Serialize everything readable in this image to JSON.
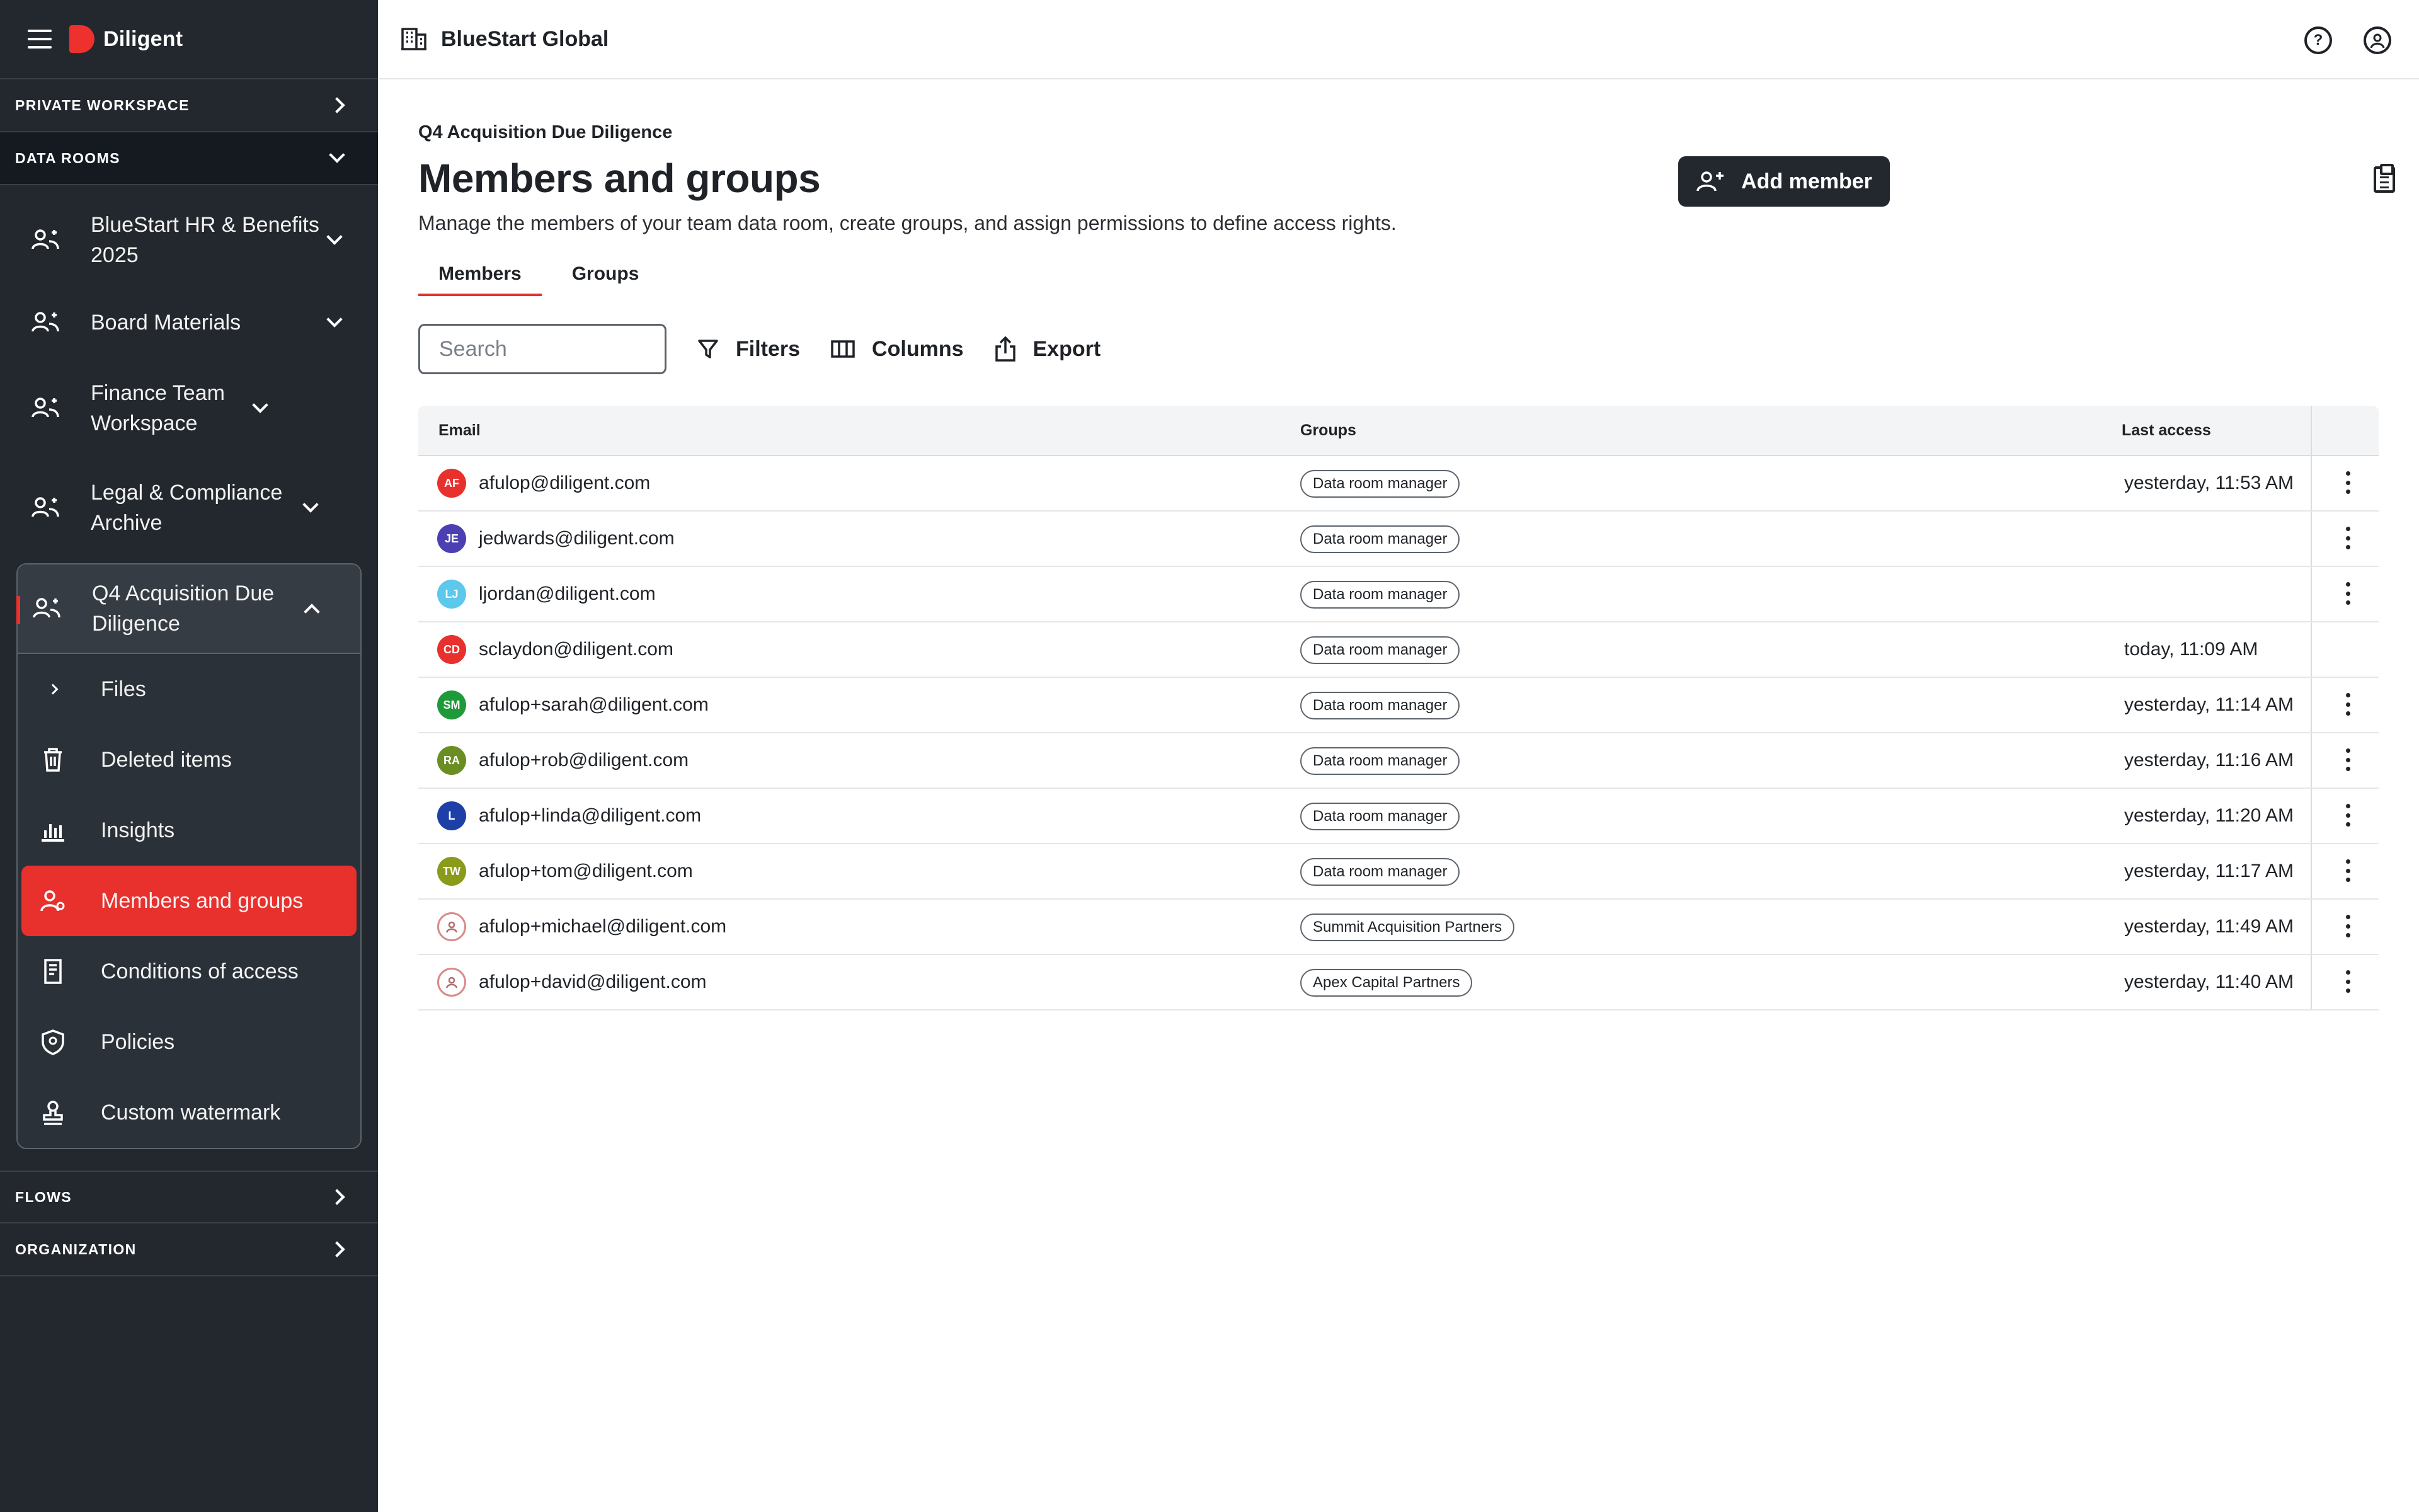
{
  "brand": {
    "name": "Diligent"
  },
  "sidebar": {
    "private_workspace": "PRIVATE WORKSPACE",
    "data_rooms": "DATA ROOMS",
    "rooms": [
      {
        "label": "BlueStart HR & Benefits 2025"
      },
      {
        "label": "Board Materials"
      },
      {
        "label": "Finance Team Workspace"
      },
      {
        "label": "Legal & Compliance Archive"
      }
    ],
    "active_room": "Q4 Acquisition Due Diligence",
    "sub_items": [
      {
        "label": "Files",
        "icon": "chevron-right-icon"
      },
      {
        "label": "Deleted items",
        "icon": "trash-icon"
      },
      {
        "label": "Insights",
        "icon": "bar-chart-icon"
      },
      {
        "label": "Members and groups",
        "icon": "members-icon"
      },
      {
        "label": "Conditions of access",
        "icon": "document-icon"
      },
      {
        "label": "Policies",
        "icon": "shield-icon"
      },
      {
        "label": "Custom watermark",
        "icon": "stamp-icon"
      }
    ],
    "flows": "FLOWS",
    "organization": "ORGANIZATION"
  },
  "topbar": {
    "org_name": "BlueStart Global"
  },
  "main": {
    "breadcrumb": "Q4 Acquisition Due Diligence",
    "title": "Members and groups",
    "subtitle": "Manage the members of your team data room, create groups, and assign permissions to define access rights.",
    "add_member": "Add member",
    "tabs": [
      "Members",
      "Groups"
    ],
    "search_placeholder": "Search",
    "filters": "Filters",
    "columns": "Columns",
    "export": "Export"
  },
  "table": {
    "headers": {
      "email": "Email",
      "groups": "Groups",
      "last_access": "Last access"
    },
    "rows": [
      {
        "initials": "AF",
        "color": "#e8302d",
        "email": "afulop@diligent.com",
        "group": "Data room manager",
        "last": "yesterday, 11:53 AM",
        "menu": true
      },
      {
        "initials": "JE",
        "color": "#4b3fb3",
        "email": "jedwards@diligent.com",
        "group": "Data room manager",
        "last": "",
        "menu": true
      },
      {
        "initials": "LJ",
        "color": "#5bc8ec",
        "email": "ljordan@diligent.com",
        "group": "Data room manager",
        "last": "",
        "menu": true
      },
      {
        "initials": "CD",
        "color": "#e8302d",
        "email": "sclaydon@diligent.com",
        "group": "Data room manager",
        "last": "today, 11:09 AM",
        "menu": false
      },
      {
        "initials": "SM",
        "color": "#1f9a3a",
        "email": "afulop+sarah@diligent.com",
        "group": "Data room manager",
        "last": "yesterday, 11:14 AM",
        "menu": true
      },
      {
        "initials": "RA",
        "color": "#6b8e23",
        "email": "afulop+rob@diligent.com",
        "group": "Data room manager",
        "last": "yesterday, 11:16 AM",
        "menu": true
      },
      {
        "initials": "L",
        "color": "#1e3fa8",
        "email": "afulop+linda@diligent.com",
        "group": "Data room manager",
        "last": "yesterday, 11:20 AM",
        "menu": true
      },
      {
        "initials": "TW",
        "color": "#8a9a1b",
        "email": "afulop+tom@diligent.com",
        "group": "Data room manager",
        "last": "yesterday, 11:17 AM",
        "menu": true
      },
      {
        "initials": "",
        "color": "outline",
        "email": "afulop+michael@diligent.com",
        "group": "Summit Acquisition Partners",
        "last": "yesterday, 11:49 AM",
        "menu": true
      },
      {
        "initials": "",
        "color": "outline",
        "email": "afulop+david@diligent.com",
        "group": "Apex Capital Partners",
        "last": "yesterday, 11:40 AM",
        "menu": true
      }
    ]
  }
}
